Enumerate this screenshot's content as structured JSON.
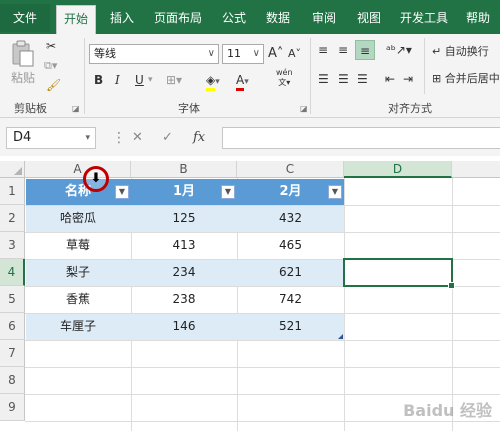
{
  "ribbon_tabs": {
    "file": "文件",
    "home": "开始",
    "insert": "插入",
    "layout": "页面布局",
    "formulas": "公式",
    "data": "数据",
    "review": "审阅",
    "view": "视图",
    "developer": "开发工具",
    "help": "帮助"
  },
  "clipboard": {
    "paste": "粘贴",
    "group": "剪贴板"
  },
  "font": {
    "name": "等线",
    "size": "11",
    "grow": "A",
    "shrink": "A",
    "bold": "B",
    "italic": "I",
    "underline": "U",
    "color_letter": "A",
    "phonetic": "wén",
    "group": "字体"
  },
  "alignment": {
    "wrap": "自动换行",
    "merge": "合并后居中",
    "group": "对齐方式"
  },
  "formula_bar": {
    "name_box": "D4",
    "fx": "fx",
    "content": ""
  },
  "columns": [
    "A",
    "B",
    "C",
    "D"
  ],
  "rows": [
    "1",
    "2",
    "3",
    "4",
    "5",
    "6",
    "7",
    "8",
    "9"
  ],
  "table": {
    "headers": [
      "名称",
      "1月",
      "2月"
    ],
    "rows": [
      [
        "哈密瓜",
        "125",
        "432"
      ],
      [
        "草莓",
        "413",
        "465"
      ],
      [
        "梨子",
        "234",
        "621"
      ],
      [
        "香蕉",
        "238",
        "742"
      ],
      [
        "车厘子",
        "146",
        "521"
      ]
    ]
  },
  "selected_cell": "D4",
  "watermark": "Baidu 经验",
  "colors": {
    "accent": "#217346",
    "table_header": "#5b9bd5",
    "table_band": "#ddebf7",
    "cursor_ring": "#c00000"
  }
}
